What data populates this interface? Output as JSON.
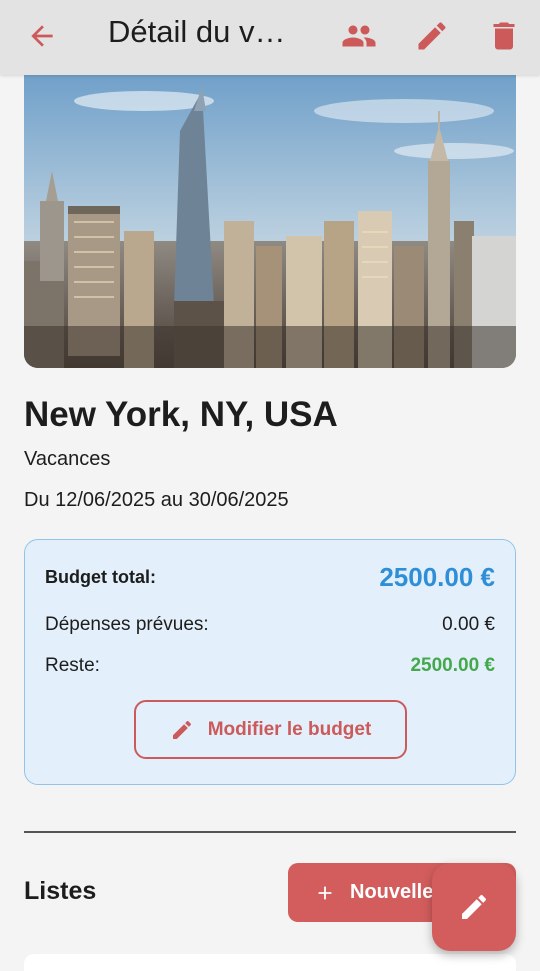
{
  "appbar": {
    "title": "Détail du v…",
    "icons": [
      "arrow-back-icon",
      "group-icon",
      "edit-icon",
      "delete-icon"
    ],
    "color": "#cc5a5a"
  },
  "trip": {
    "title": "New York, NY, USA",
    "category": "Vacances",
    "dates": "Du 12/06/2025 au 30/06/2025"
  },
  "budget": {
    "total_label": "Budget total:",
    "total_value": "2500.00 €",
    "spent_label": "Dépenses prévues:",
    "spent_value": "0.00 €",
    "rest_label": "Reste:",
    "rest_value": "2500.00 €",
    "modify_label": "Modifier le budget",
    "colors": {
      "total": "#2f8fd6",
      "rest": "#45a84d",
      "accent": "#cc5a5a"
    }
  },
  "lists": {
    "title": "Listes",
    "new_label": "Nouvelle"
  },
  "fab": {
    "icon": "edit-icon"
  }
}
